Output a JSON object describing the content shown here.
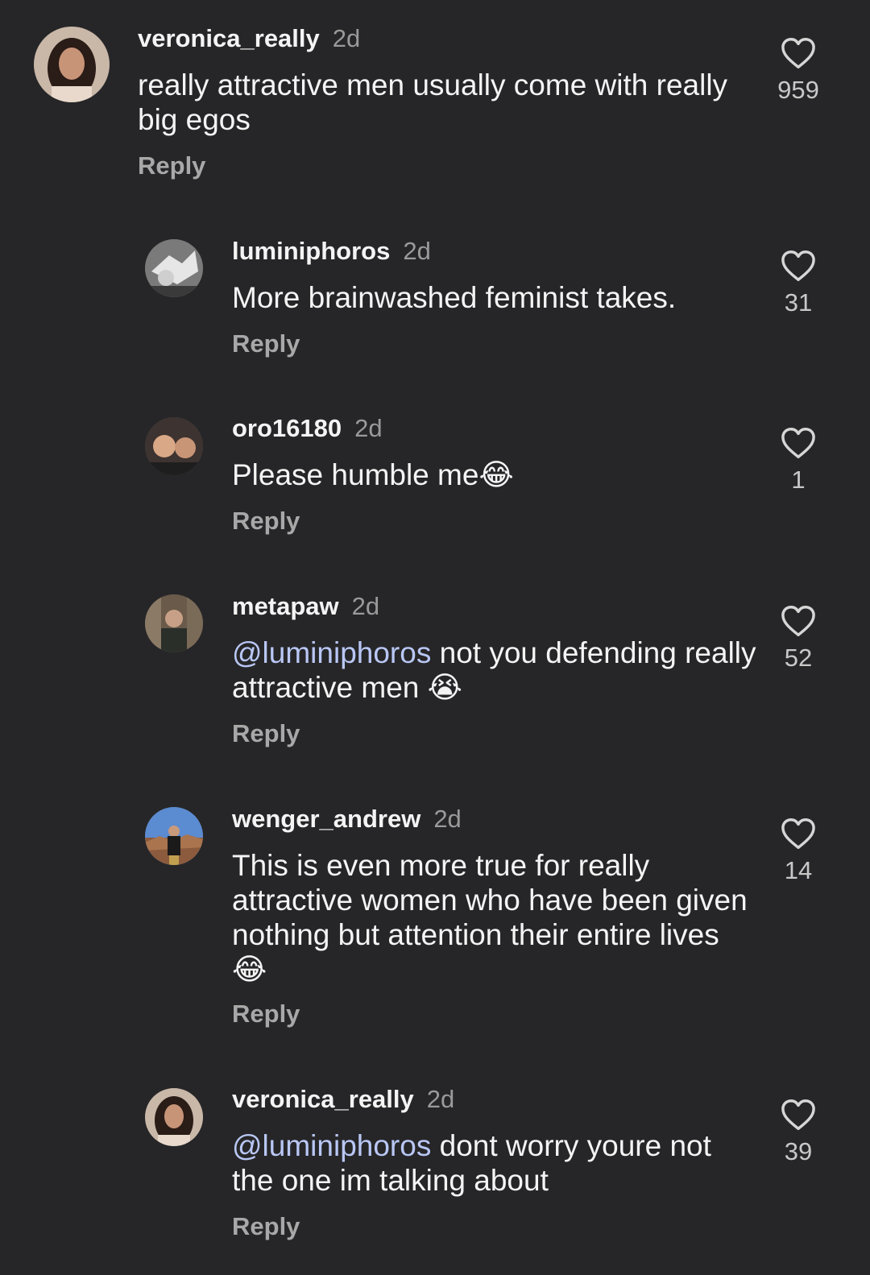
{
  "comments": [
    {
      "username": "veronica_really",
      "time": "2d",
      "mention": "",
      "text": "really attractive men usually come with really big egos",
      "emoji": "",
      "reply": "Reply",
      "likes": "959"
    },
    {
      "username": "luminiphoros",
      "time": "2d",
      "mention": "",
      "text": "More brainwashed feminist takes.",
      "emoji": "",
      "reply": "Reply",
      "likes": "31"
    },
    {
      "username": "oro16180",
      "time": "2d",
      "mention": "",
      "text": "Please humble me",
      "emoji": "😂",
      "reply": "Reply",
      "likes": "1"
    },
    {
      "username": "metapaw",
      "time": "2d",
      "mention": "@luminiphoros",
      "text": " not you defending really attractive men ",
      "emoji": "😭",
      "reply": "Reply",
      "likes": "52"
    },
    {
      "username": "wenger_andrew",
      "time": "2d",
      "mention": "",
      "text": "This is even more true for really attractive women who have been given nothing but attention their entire lives ",
      "emoji": "😂",
      "reply": "Reply",
      "likes": "14"
    },
    {
      "username": "veronica_really",
      "time": "2d",
      "mention": "@luminiphoros",
      "text": " dont worry youre not the one im talking about",
      "emoji": "",
      "reply": "Reply",
      "likes": "39"
    }
  ],
  "icons": {
    "like": "heart-outline-icon",
    "avatar": "profile-photo"
  },
  "colors": {
    "background": "#262628",
    "mention": "#b9c7f5",
    "muted": "#9a9a9a"
  }
}
